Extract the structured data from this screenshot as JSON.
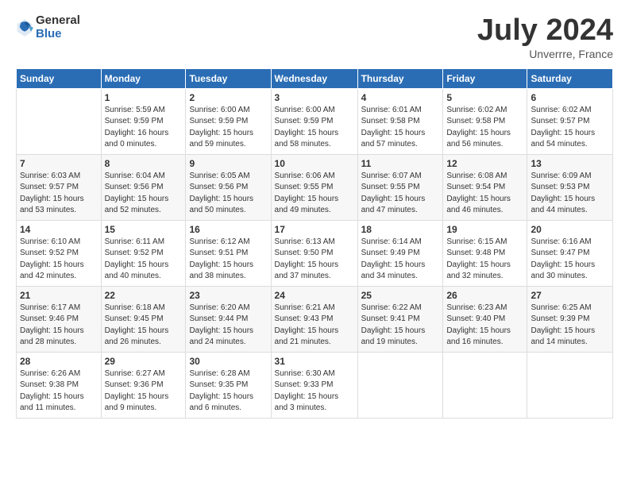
{
  "logo": {
    "general": "General",
    "blue": "Blue"
  },
  "title": "July 2024",
  "location": "Unverrre, France",
  "headers": [
    "Sunday",
    "Monday",
    "Tuesday",
    "Wednesday",
    "Thursday",
    "Friday",
    "Saturday"
  ],
  "weeks": [
    [
      {
        "day": "",
        "info": ""
      },
      {
        "day": "1",
        "info": "Sunrise: 5:59 AM\nSunset: 9:59 PM\nDaylight: 16 hours\nand 0 minutes."
      },
      {
        "day": "2",
        "info": "Sunrise: 6:00 AM\nSunset: 9:59 PM\nDaylight: 15 hours\nand 59 minutes."
      },
      {
        "day": "3",
        "info": "Sunrise: 6:00 AM\nSunset: 9:59 PM\nDaylight: 15 hours\nand 58 minutes."
      },
      {
        "day": "4",
        "info": "Sunrise: 6:01 AM\nSunset: 9:58 PM\nDaylight: 15 hours\nand 57 minutes."
      },
      {
        "day": "5",
        "info": "Sunrise: 6:02 AM\nSunset: 9:58 PM\nDaylight: 15 hours\nand 56 minutes."
      },
      {
        "day": "6",
        "info": "Sunrise: 6:02 AM\nSunset: 9:57 PM\nDaylight: 15 hours\nand 54 minutes."
      }
    ],
    [
      {
        "day": "7",
        "info": "Sunrise: 6:03 AM\nSunset: 9:57 PM\nDaylight: 15 hours\nand 53 minutes."
      },
      {
        "day": "8",
        "info": "Sunrise: 6:04 AM\nSunset: 9:56 PM\nDaylight: 15 hours\nand 52 minutes."
      },
      {
        "day": "9",
        "info": "Sunrise: 6:05 AM\nSunset: 9:56 PM\nDaylight: 15 hours\nand 50 minutes."
      },
      {
        "day": "10",
        "info": "Sunrise: 6:06 AM\nSunset: 9:55 PM\nDaylight: 15 hours\nand 49 minutes."
      },
      {
        "day": "11",
        "info": "Sunrise: 6:07 AM\nSunset: 9:55 PM\nDaylight: 15 hours\nand 47 minutes."
      },
      {
        "day": "12",
        "info": "Sunrise: 6:08 AM\nSunset: 9:54 PM\nDaylight: 15 hours\nand 46 minutes."
      },
      {
        "day": "13",
        "info": "Sunrise: 6:09 AM\nSunset: 9:53 PM\nDaylight: 15 hours\nand 44 minutes."
      }
    ],
    [
      {
        "day": "14",
        "info": "Sunrise: 6:10 AM\nSunset: 9:52 PM\nDaylight: 15 hours\nand 42 minutes."
      },
      {
        "day": "15",
        "info": "Sunrise: 6:11 AM\nSunset: 9:52 PM\nDaylight: 15 hours\nand 40 minutes."
      },
      {
        "day": "16",
        "info": "Sunrise: 6:12 AM\nSunset: 9:51 PM\nDaylight: 15 hours\nand 38 minutes."
      },
      {
        "day": "17",
        "info": "Sunrise: 6:13 AM\nSunset: 9:50 PM\nDaylight: 15 hours\nand 37 minutes."
      },
      {
        "day": "18",
        "info": "Sunrise: 6:14 AM\nSunset: 9:49 PM\nDaylight: 15 hours\nand 34 minutes."
      },
      {
        "day": "19",
        "info": "Sunrise: 6:15 AM\nSunset: 9:48 PM\nDaylight: 15 hours\nand 32 minutes."
      },
      {
        "day": "20",
        "info": "Sunrise: 6:16 AM\nSunset: 9:47 PM\nDaylight: 15 hours\nand 30 minutes."
      }
    ],
    [
      {
        "day": "21",
        "info": "Sunrise: 6:17 AM\nSunset: 9:46 PM\nDaylight: 15 hours\nand 28 minutes."
      },
      {
        "day": "22",
        "info": "Sunrise: 6:18 AM\nSunset: 9:45 PM\nDaylight: 15 hours\nand 26 minutes."
      },
      {
        "day": "23",
        "info": "Sunrise: 6:20 AM\nSunset: 9:44 PM\nDaylight: 15 hours\nand 24 minutes."
      },
      {
        "day": "24",
        "info": "Sunrise: 6:21 AM\nSunset: 9:43 PM\nDaylight: 15 hours\nand 21 minutes."
      },
      {
        "day": "25",
        "info": "Sunrise: 6:22 AM\nSunset: 9:41 PM\nDaylight: 15 hours\nand 19 minutes."
      },
      {
        "day": "26",
        "info": "Sunrise: 6:23 AM\nSunset: 9:40 PM\nDaylight: 15 hours\nand 16 minutes."
      },
      {
        "day": "27",
        "info": "Sunrise: 6:25 AM\nSunset: 9:39 PM\nDaylight: 15 hours\nand 14 minutes."
      }
    ],
    [
      {
        "day": "28",
        "info": "Sunrise: 6:26 AM\nSunset: 9:38 PM\nDaylight: 15 hours\nand 11 minutes."
      },
      {
        "day": "29",
        "info": "Sunrise: 6:27 AM\nSunset: 9:36 PM\nDaylight: 15 hours\nand 9 minutes."
      },
      {
        "day": "30",
        "info": "Sunrise: 6:28 AM\nSunset: 9:35 PM\nDaylight: 15 hours\nand 6 minutes."
      },
      {
        "day": "31",
        "info": "Sunrise: 6:30 AM\nSunset: 9:33 PM\nDaylight: 15 hours\nand 3 minutes."
      },
      {
        "day": "",
        "info": ""
      },
      {
        "day": "",
        "info": ""
      },
      {
        "day": "",
        "info": ""
      }
    ]
  ]
}
